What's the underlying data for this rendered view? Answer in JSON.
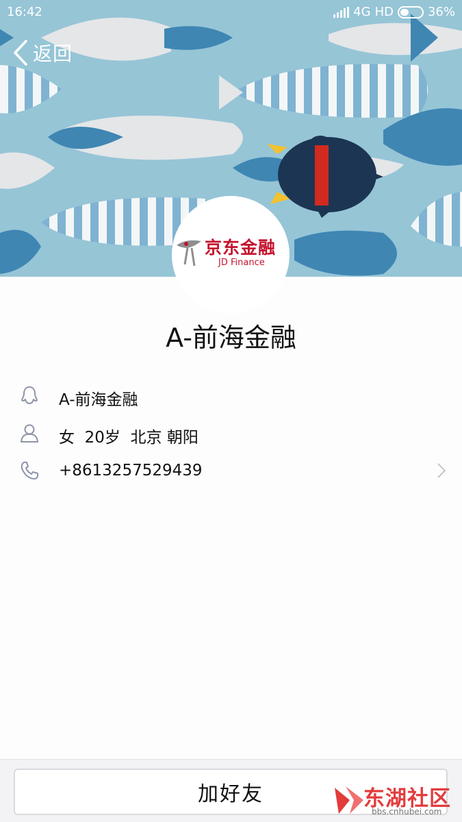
{
  "status_bar": {
    "time": "16:42",
    "network": "4G",
    "hd": "HD",
    "battery": "36%"
  },
  "nav": {
    "back_label": "返回"
  },
  "avatar": {
    "logo_text": "京东金融",
    "logo_sub": "JD Finance"
  },
  "profile": {
    "name": "A-前海金融",
    "rows": [
      {
        "icon": "qq-penguin-icon",
        "text": "A-前海金融"
      },
      {
        "icon": "person-icon",
        "text": "女  20岁  北京 朝阳"
      },
      {
        "icon": "phone-icon",
        "text": "+8613257529439"
      }
    ]
  },
  "actions": {
    "add_friend_label": "加好友"
  },
  "watermark": {
    "title": "东湖社区",
    "url": "bbs.cnhubei.com"
  },
  "colors": {
    "banner_bg": "#96c5d6",
    "accent_red": "#c4132e",
    "watermark_red": "#e23c3c"
  }
}
